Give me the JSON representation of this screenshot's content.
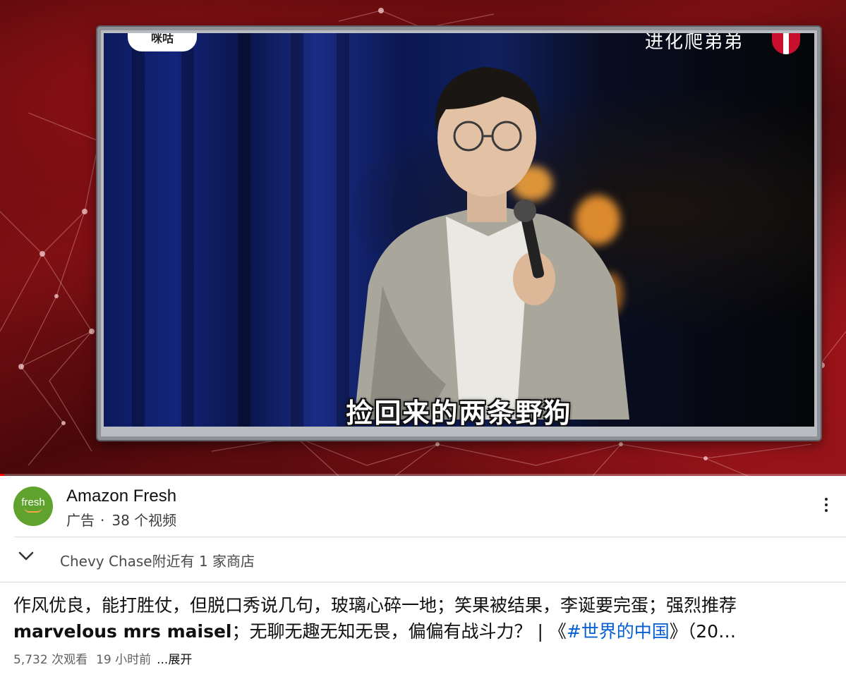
{
  "player": {
    "screen_logo": "咪咕",
    "screen_top_caption": "进化爬弟弟",
    "subtitle": "捡回来的两条野狗",
    "progress_fraction": 0.005,
    "colors": {
      "progress": "#ff0000",
      "background": "#7a0f13"
    }
  },
  "ad": {
    "logo_text": "fresh",
    "title": "Amazon Fresh",
    "label": "广告",
    "video_count": "38 个视频",
    "menu_icon": "more-vert-icon",
    "brand_color": "#5fa32e"
  },
  "store": {
    "icon": "chevron-down-icon",
    "text": "Chevy Chase附近有 1 家商店"
  },
  "video": {
    "title_part1": "作风优良，能打胜仗，但脱口秀说几句，玻璃心碎一地；笑果被结果，李诞要完蛋；强烈推荐 ",
    "title_latin": "marvelous mrs maisel",
    "title_part2": "；无聊无趣无知无畏，偏偏有战斗力？ | 《",
    "title_hashtag": "#世界的中国",
    "title_part3": "》（20…",
    "views": "5,732 次观看",
    "age": "19 小时前",
    "expand": "...展开",
    "hashtag_color": "#065fd4"
  }
}
